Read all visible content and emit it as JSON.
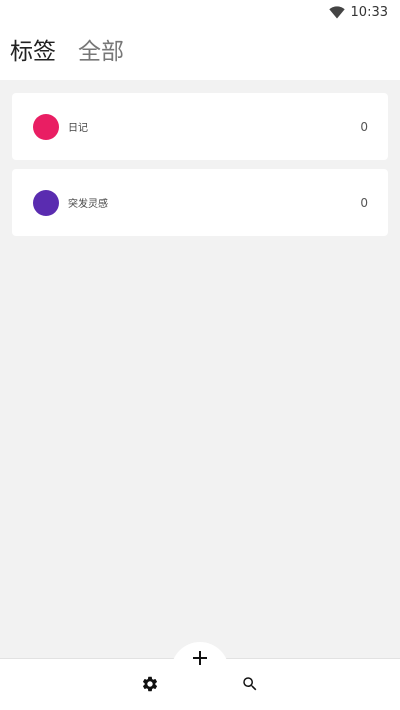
{
  "status_bar": {
    "time": "10:33"
  },
  "header": {
    "tabs": [
      {
        "label": "标签",
        "active": true
      },
      {
        "label": "全部",
        "active": false
      }
    ]
  },
  "tags": [
    {
      "name": "日记",
      "count": "0",
      "color": "#E91E63"
    },
    {
      "name": "突发灵感",
      "count": "0",
      "color": "#5A2CB0"
    }
  ],
  "bottom_bar": {
    "left_icon": "gear-icon",
    "center_icon": "plus-icon",
    "right_icon": "search-icon"
  }
}
